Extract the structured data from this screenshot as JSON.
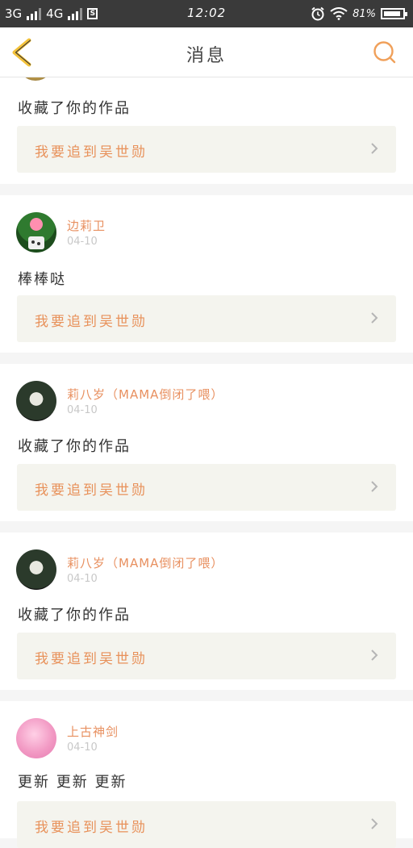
{
  "status_bar": {
    "net1": "3G",
    "net2": "4G",
    "time": "12:02",
    "battery": "81%",
    "battery_level": 0.81
  },
  "header": {
    "title": "消息",
    "back_icon": "back-chevron-icon",
    "search_icon": "search-icon",
    "accent_color": "#f0a05a"
  },
  "feed": [
    {
      "action": "收藏了你的作品",
      "work_title": "我要追到吴世勋"
    },
    {
      "name": "边莉卫",
      "date": "04-10",
      "action": "棒棒哒",
      "work_title": "我要追到吴世勋"
    },
    {
      "name": "莉八岁（MAMA倒闭了喂）",
      "date": "04-10",
      "action": "收藏了你的作品",
      "work_title": "我要追到吴世勋"
    },
    {
      "name": "莉八岁（MAMA倒闭了喂）",
      "date": "04-10",
      "action": "收藏了你的作品",
      "work_title": "我要追到吴世勋"
    },
    {
      "name": "上古神剑",
      "date": "04-10",
      "action": "更新 更新 更新",
      "work_title": "我要追到吴世勋"
    }
  ]
}
